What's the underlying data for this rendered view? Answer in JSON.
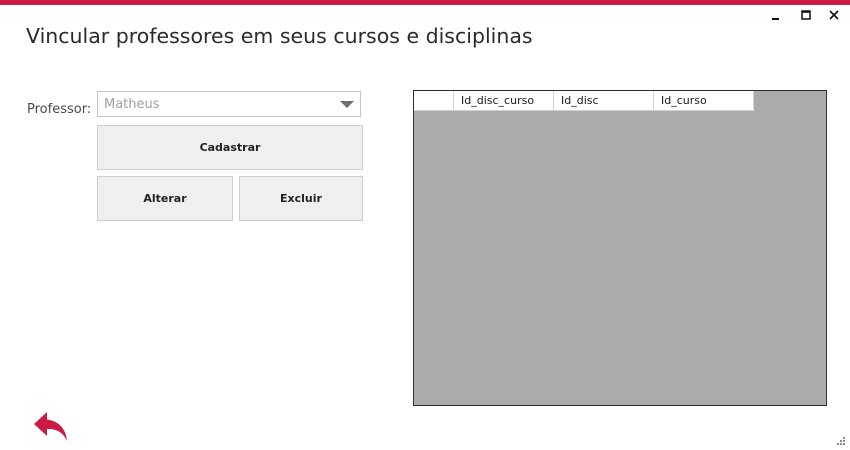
{
  "window": {
    "title": "Vincular professores em seus cursos e disciplinas",
    "accent_color": "#cc1a45",
    "controls": [
      "minimize-icon",
      "maximize-icon",
      "close-icon"
    ]
  },
  "form": {
    "professor_label": "Professor:",
    "professor_value": "Matheus"
  },
  "buttons": {
    "cadastrar": "Cadastrar",
    "alterar": "Alterar",
    "excluir": "Excluir"
  },
  "grid": {
    "columns": [
      "Id_disc_curso",
      "Id_disc",
      "Id_curso"
    ],
    "rows": []
  },
  "footer": {
    "back_icon": "back-arrow-icon",
    "resize_icon": "resize-grip-icon"
  }
}
